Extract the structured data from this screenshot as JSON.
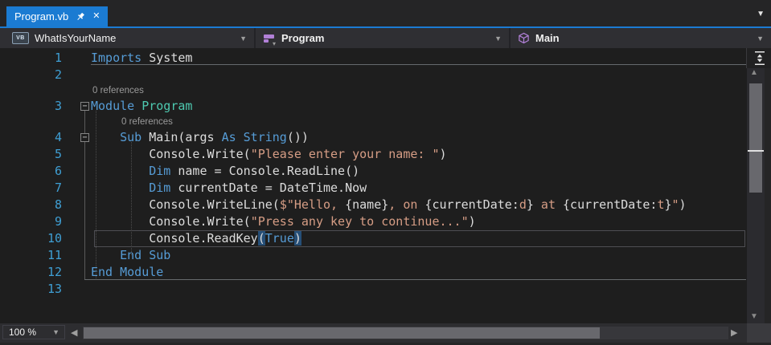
{
  "tab_bar": {
    "active_tab": "Program.vb"
  },
  "navbar": {
    "project": {
      "badge": "VB",
      "label": "WhatIsYourName"
    },
    "type": {
      "label": "Program"
    },
    "member": {
      "label": "Main"
    }
  },
  "status_bar": {
    "zoom_value": "100 %"
  },
  "icons": {
    "pin": "pin-icon",
    "close": "✕",
    "tab_overflow": "▼",
    "dropdown": "▼",
    "fold_collapse": "−",
    "scroll_up": "▲",
    "scroll_down": "▼",
    "scroll_left": "◀",
    "scroll_right": "▶"
  },
  "colors": {
    "accent": "#1b7bd2",
    "chrome_bg": "#252526",
    "navbar_bg": "#2f2f33",
    "editor_bg": "#1e1e1e",
    "keyword": "#569CD6",
    "type": "#4EC9B0",
    "string": "#D69D85",
    "plain": "#DCDCDC",
    "line_number": "#3F9FD4",
    "codelens": "#9a9a9a",
    "brace_match_bg": "#264F78",
    "scroll_thumb": "#68686d"
  },
  "editor": {
    "rows": [
      {
        "kind": "code",
        "num": "1",
        "tokens": [
          {
            "t": "Imports",
            "c": "kw"
          },
          {
            "t": " System",
            "c": "pl"
          }
        ]
      },
      {
        "kind": "code",
        "num": "2",
        "tokens": []
      },
      {
        "kind": "lens",
        "text": "0 references",
        "pad": 2
      },
      {
        "kind": "code",
        "num": "3",
        "collapse": true,
        "tokens": [
          {
            "t": "Module",
            "c": "kw"
          },
          {
            "t": " ",
            "c": "pl"
          },
          {
            "t": "Program",
            "c": "ty"
          }
        ]
      },
      {
        "kind": "lens",
        "text": "0 references",
        "pad": 38
      },
      {
        "kind": "code",
        "num": "4",
        "collapse": true,
        "tokens": [
          {
            "t": "    ",
            "c": "pl"
          },
          {
            "t": "Sub",
            "c": "kw"
          },
          {
            "t": " Main(args ",
            "c": "pl"
          },
          {
            "t": "As",
            "c": "kw"
          },
          {
            "t": " ",
            "c": "pl"
          },
          {
            "t": "String",
            "c": "kw"
          },
          {
            "t": "())",
            "c": "pl"
          }
        ]
      },
      {
        "kind": "code",
        "num": "5",
        "tokens": [
          {
            "t": "        Console.Write(",
            "c": "pl"
          },
          {
            "t": "\"Please enter your name: \"",
            "c": "st"
          },
          {
            "t": ")",
            "c": "pl"
          }
        ]
      },
      {
        "kind": "code",
        "num": "6",
        "tokens": [
          {
            "t": "        ",
            "c": "pl"
          },
          {
            "t": "Dim",
            "c": "kw"
          },
          {
            "t": " name = Console.ReadLine()",
            "c": "pl"
          }
        ]
      },
      {
        "kind": "code",
        "num": "7",
        "tokens": [
          {
            "t": "        ",
            "c": "pl"
          },
          {
            "t": "Dim",
            "c": "kw"
          },
          {
            "t": " currentDate = DateTime.Now",
            "c": "pl"
          }
        ]
      },
      {
        "kind": "code",
        "num": "8",
        "tokens": [
          {
            "t": "        Console.WriteLine(",
            "c": "pl"
          },
          {
            "t": "$",
            "c": "st"
          },
          {
            "t": "\"Hello, ",
            "c": "st"
          },
          {
            "t": "{name}",
            "c": "pl"
          },
          {
            "t": ", on ",
            "c": "st"
          },
          {
            "t": "{currentDate:",
            "c": "pl"
          },
          {
            "t": "d",
            "c": "st"
          },
          {
            "t": "}",
            "c": "pl"
          },
          {
            "t": " at ",
            "c": "st"
          },
          {
            "t": "{currentDate:",
            "c": "pl"
          },
          {
            "t": "t",
            "c": "st"
          },
          {
            "t": "}",
            "c": "pl"
          },
          {
            "t": "\"",
            "c": "st"
          },
          {
            "t": ")",
            "c": "pl"
          }
        ]
      },
      {
        "kind": "code",
        "num": "9",
        "tokens": [
          {
            "t": "        Console.Write(",
            "c": "pl"
          },
          {
            "t": "\"Press any key to continue...\"",
            "c": "st"
          },
          {
            "t": ")",
            "c": "pl"
          }
        ]
      },
      {
        "kind": "code",
        "num": "10",
        "current": true,
        "tokens": [
          {
            "t": "        Console.ReadKey",
            "c": "pl"
          },
          {
            "t": "(",
            "c": "pl",
            "hl": true
          },
          {
            "t": "True",
            "c": "kw"
          },
          {
            "t": ")",
            "c": "pl",
            "hl": true
          }
        ]
      },
      {
        "kind": "code",
        "num": "11",
        "tokens": [
          {
            "t": "    ",
            "c": "pl"
          },
          {
            "t": "End Sub",
            "c": "kw"
          }
        ]
      },
      {
        "kind": "code",
        "num": "12",
        "tokens": [
          {
            "t": "End Module",
            "c": "kw"
          }
        ]
      },
      {
        "kind": "code",
        "num": "13",
        "tokens": []
      }
    ]
  }
}
